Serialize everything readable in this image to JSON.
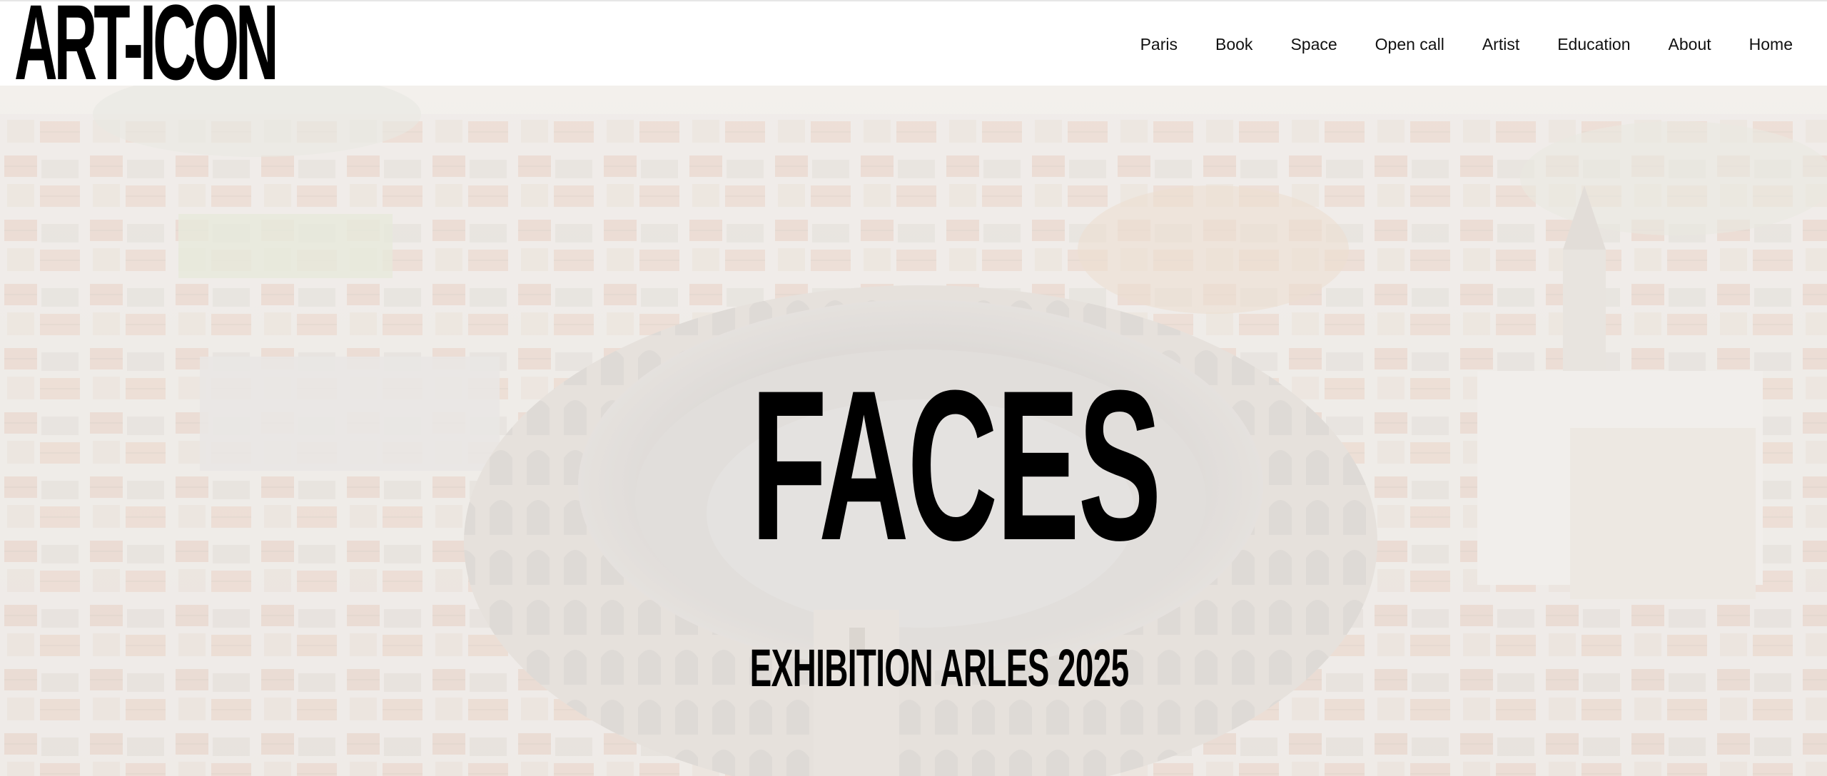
{
  "header": {
    "logo_text": "ART-ICON",
    "nav": [
      {
        "label": "Paris"
      },
      {
        "label": "Book"
      },
      {
        "label": "Space"
      },
      {
        "label": "Open call"
      },
      {
        "label": "Artist"
      },
      {
        "label": "Education"
      },
      {
        "label": "About"
      },
      {
        "label": "Home"
      }
    ]
  },
  "hero": {
    "title": "FACES",
    "subtitle": "EXHIBITION ARLES 2025",
    "background": "aerial photo of the Arles amphitheatre and surrounding old town, faded white overlay"
  },
  "colors": {
    "text": "#000000",
    "header_bg": "#ffffff",
    "hero_tint": "#ede9e4",
    "roof_accent": "#d9a98e"
  }
}
